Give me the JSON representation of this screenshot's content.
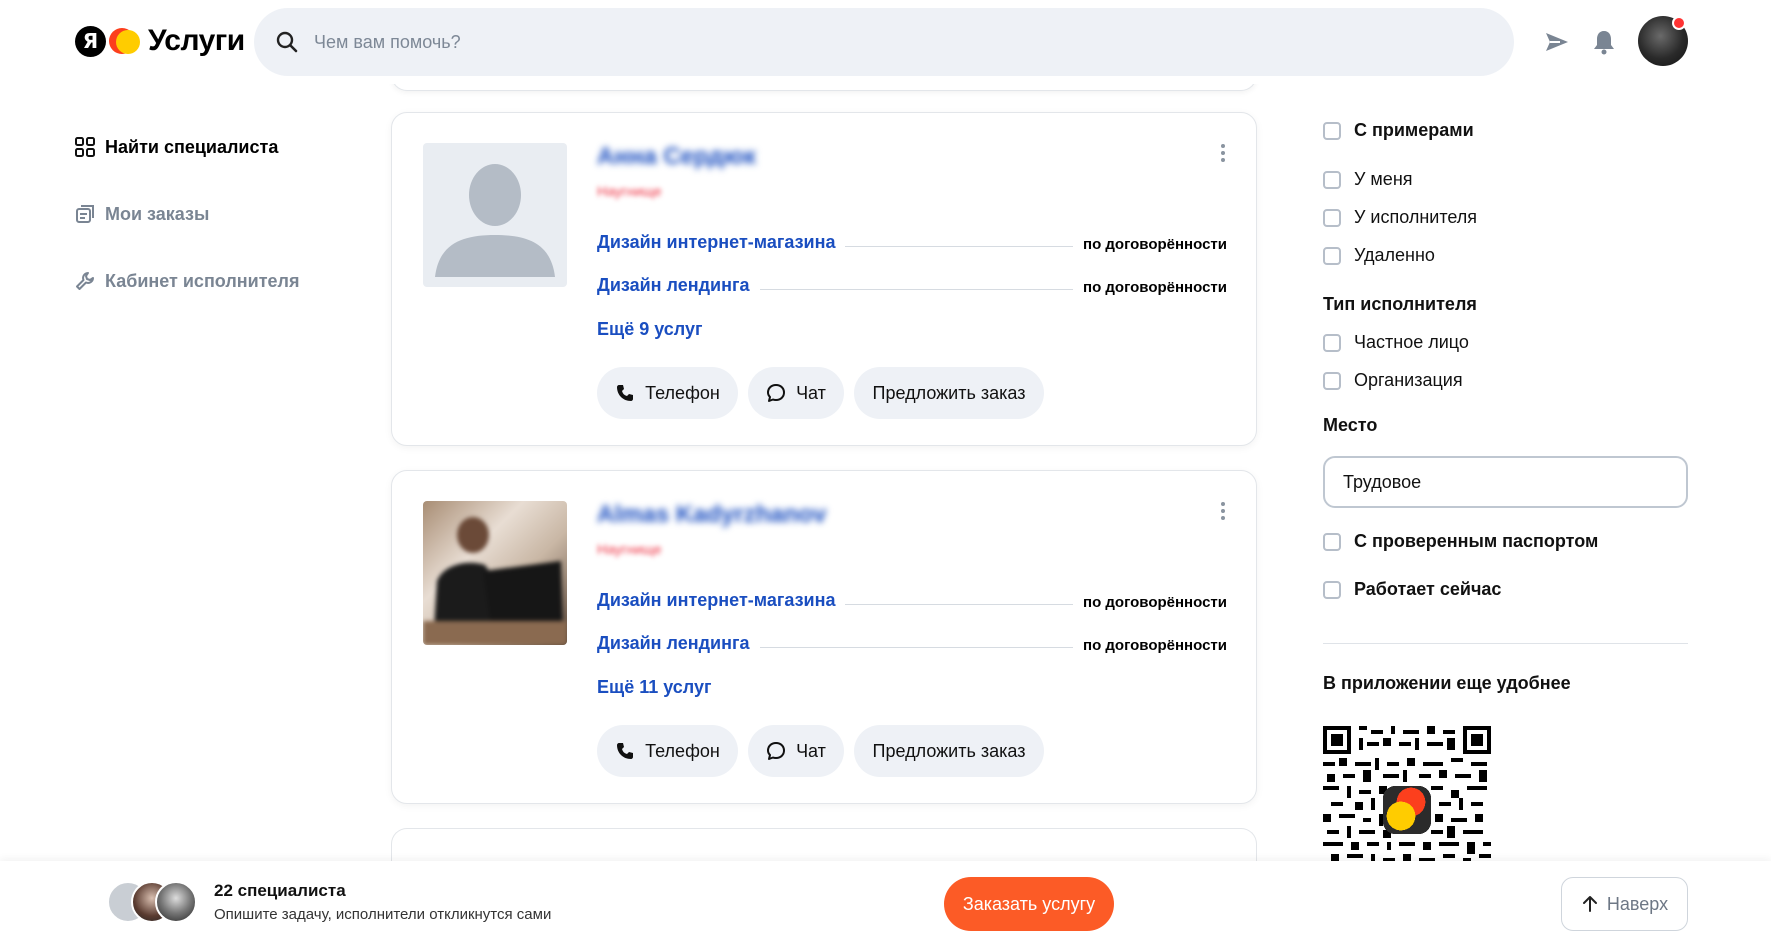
{
  "header": {
    "logo_mark": "Я",
    "logo_text": "Услуги",
    "search_placeholder": "Чем вам помочь?"
  },
  "nav": {
    "items": [
      {
        "label": "Найти специалиста",
        "icon": "grid-icon"
      },
      {
        "label": "Мои заказы",
        "icon": "orders-icon"
      },
      {
        "label": "Кабинет исполнителя",
        "icon": "wrench-icon"
      }
    ]
  },
  "cards": [
    {
      "name": "Анна Сердюк",
      "subtitle": "Наугнище",
      "services": [
        {
          "name": "Дизайн интернет-магазина",
          "price": "по договорённости"
        },
        {
          "name": "Дизайн лендинга",
          "price": "по договорённости"
        }
      ],
      "more": "Ещё 9 услуг",
      "phone_label": "Телефон",
      "chat_label": "Чат",
      "offer_label": "Предложить заказ"
    },
    {
      "name": "Almas Kadyrzhanov",
      "subtitle": "Наугнище",
      "services": [
        {
          "name": "Дизайн интернет-магазина",
          "price": "по договорённости"
        },
        {
          "name": "Дизайн лендинга",
          "price": "по договорённости"
        }
      ],
      "more": "Ещё 11 услуг",
      "phone_label": "Телефон",
      "chat_label": "Чат",
      "offer_label": "Предложить заказ"
    }
  ],
  "filters": {
    "with_examples": "С примерами",
    "location_options": [
      "У меня",
      "У исполнителя",
      "Удаленно"
    ],
    "executor_type_title": "Тип исполнителя",
    "executor_types": [
      "Частное лицо",
      "Организация"
    ],
    "place_title": "Место",
    "place_value": "Трудовое",
    "verified_passport": "С проверенным паспортом",
    "works_now": "Работает сейчас",
    "app_promo": "В приложении еще удобнее"
  },
  "footer": {
    "count": "22 специалиста",
    "description": "Опишите задачу, исполнители откликнутся сами",
    "order_button": "Заказать услугу",
    "top_button": "Наверх"
  },
  "colors": {
    "accent_orange": "#fc5b26",
    "link_blue": "#1a4ec0",
    "button_bg": "#eef1f6"
  }
}
